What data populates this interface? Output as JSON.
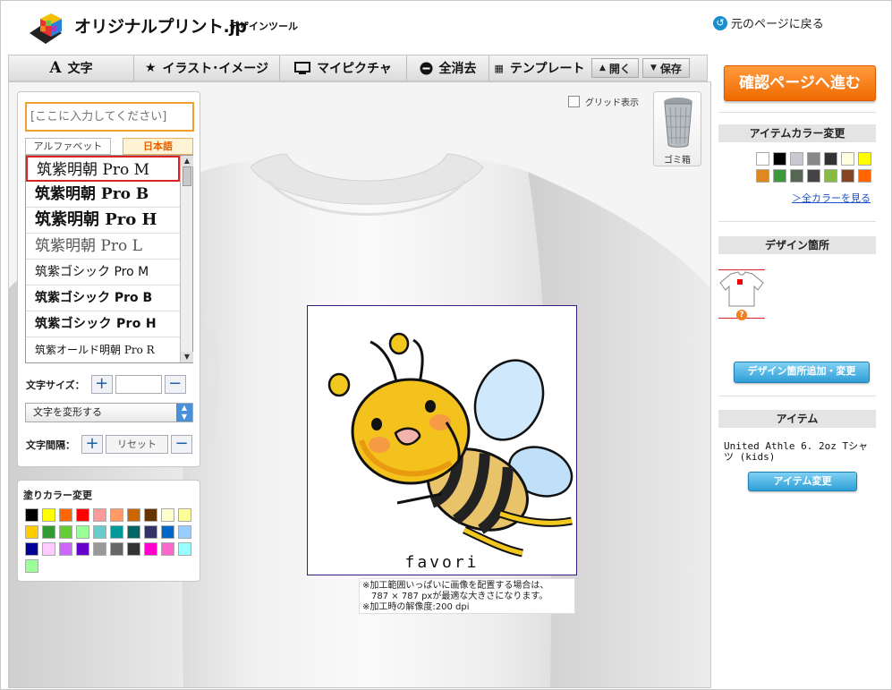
{
  "header": {
    "logo_text": "オリジナルプリント.jp",
    "logo_sub": "デザインツール",
    "back_link": "元のページに戻る"
  },
  "toolbar": {
    "text": "文字",
    "illustration": "イラスト･イメージ",
    "my_picture": "マイピクチャ",
    "clear_all": "全消去",
    "template": "テンプレート",
    "open": "開く",
    "save": "保存"
  },
  "text_panel": {
    "input_placeholder": "[ここに入力してください]",
    "tab_alphabet": "アルファベット",
    "tab_japanese": "日本語",
    "fonts": [
      "筑紫明朝 Pro M",
      "筑紫明朝 Pro B",
      "筑紫明朝 Pro H",
      "筑紫明朝 Pro L",
      "筑紫ゴシック Pro M",
      "筑紫ゴシック Pro B",
      "筑紫ゴシック Pro H",
      "筑紫オールド明朝 Pro R"
    ],
    "selected_font_index": 0,
    "size_label": "文字サイズ：",
    "transform_label": "文字を変形する",
    "spacing_label": "文字間隔：",
    "reset_label": "リセット",
    "plus": "+",
    "minus": "−"
  },
  "fill_panel": {
    "title": "塗りカラー変更",
    "colors": [
      "#000000",
      "#ffff00",
      "#ff6600",
      "#ff0000",
      "#ff9999",
      "#ff9966",
      "#cc6600",
      "#663300",
      "#ffffcc",
      "#ffff99",
      "#ffcc00",
      "#339933",
      "#66cc33",
      "#99ff99",
      "#66cccc",
      "#009999",
      "#006666",
      "#333366",
      "#0066cc",
      "#99ccff",
      "#000099",
      "#ffccff",
      "#cc66ff",
      "#6600cc",
      "#999999",
      "#666666",
      "#333333",
      "#ff00cc",
      "#ff66cc",
      "#99ffff",
      "#99ff99"
    ]
  },
  "canvas": {
    "grid_label": "グリッド表示",
    "trash_label": "ゴミ箱",
    "design_text": "favori",
    "note_lines": [
      "※加工範囲いっぱいに画像を配置する場合は、",
      "　787 × 787 pxが最適な大きさになります。",
      "※加工時の解像度:200 dpi"
    ]
  },
  "right_panel": {
    "confirm_button": "確認ページへ進む",
    "item_color_title": "アイテムカラー変更",
    "item_colors": [
      "#ffffff",
      "#000000",
      "#c8c8d0",
      "#888888",
      "#333333",
      "#ffffe0",
      "#ffff00",
      "#e08820",
      "#3a9a3a",
      "#556655",
      "#444444",
      "#88bb44",
      "#884422",
      "#ff6600"
    ],
    "all_colors_link": "＞全カラーを見る",
    "design_location_title": "デザイン箇所",
    "design_location_button": "デザイン箇所追加・変更",
    "item_title": "アイテム",
    "item_name": "United Athle 6. 2oz Tシャツ (kids)",
    "item_change_button": "アイテム変更"
  }
}
